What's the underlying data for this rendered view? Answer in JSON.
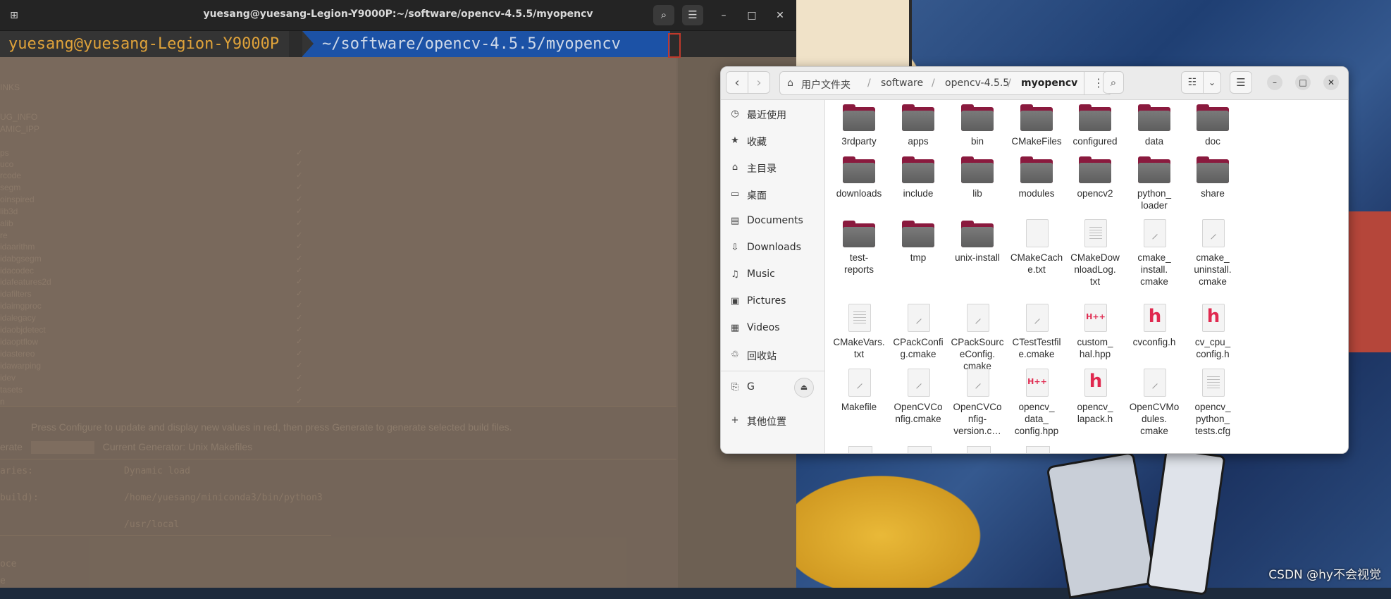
{
  "terminal": {
    "title": "yuesang@yuesang-Legion-Y9000P:~/software/opencv-4.5.5/myopencv",
    "prompt_user": "yuesang@yuesang-Legion-Y9000P",
    "prompt_path": "~/software/opencv-4.5.5/myopencv",
    "buttons": {
      "new_tab": "⊞",
      "search": "⌕",
      "menu": "☰",
      "minimize": "–",
      "maximize": "□",
      "close": "✕"
    }
  },
  "background_app": {
    "rows": [
      "INKS",
      "UG_INFO",
      "AMIC_IPP",
      "ps",
      "uco",
      "rcode",
      "segm",
      "oinspired",
      "lib3d",
      "alib",
      "re",
      "idaarithm",
      "idabgsegm",
      "idacodec",
      "idafeatures2d",
      "idafilters",
      "idaimgproc",
      "idalegacy",
      "idaobjdetect",
      "idaoptflow",
      "idastereo",
      "idawarping",
      "idev",
      "tasets",
      "n"
    ],
    "message": "Press Configure to update and display new values in red, then press Generate to generate selected build files.",
    "generate_label": "erate",
    "generator_label": "Current Generator: Unix Makefiles",
    "code_lines": [
      {
        "left": "aries:",
        "right": "Dynamic load"
      },
      {
        "left": " build):",
        "right": "/home/yuesang/miniconda3/bin/python3"
      },
      {
        "left": "",
        "right": "/usr/local"
      },
      {
        "left": "oce",
        "right": ""
      },
      {
        "left": "e",
        "right": ""
      }
    ]
  },
  "files": {
    "path": [
      "用户文件夹",
      "software",
      "opencv-4.5.5",
      "myopencv"
    ],
    "toolbar": {
      "back": "‹",
      "forward": "›",
      "path_menu": "⋮",
      "search": "⌕",
      "view": "☷",
      "view_dropdown": "⌄",
      "menu": "☰",
      "minimize": "–",
      "maximize": "□",
      "close": "✕"
    },
    "sidebar": [
      {
        "label": "最近使用",
        "icon": "clock-icon",
        "glyph": "◷"
      },
      {
        "label": "收藏",
        "icon": "star-icon",
        "glyph": "★"
      },
      {
        "label": "主目录",
        "icon": "home-icon",
        "glyph": "⌂"
      },
      {
        "label": "桌面",
        "icon": "desktop-icon",
        "glyph": "▭"
      },
      {
        "label": "Documents",
        "icon": "document-icon",
        "glyph": "▤"
      },
      {
        "label": "Downloads",
        "icon": "download-icon",
        "glyph": "⇩"
      },
      {
        "label": "Music",
        "icon": "music-icon",
        "glyph": "♫"
      },
      {
        "label": "Pictures",
        "icon": "picture-icon",
        "glyph": "▣"
      },
      {
        "label": "Videos",
        "icon": "video-icon",
        "glyph": "▦"
      },
      {
        "label": "回收站",
        "icon": "trash-icon",
        "glyph": "♲"
      },
      {
        "label": "G",
        "icon": "usb-drive-icon",
        "glyph": "⎘"
      },
      {
        "label": "其他位置",
        "icon": "plus-icon",
        "glyph": "+"
      }
    ],
    "eject": "⏏",
    "items": [
      {
        "name": "3rdparty",
        "type": "folder"
      },
      {
        "name": "apps",
        "type": "folder"
      },
      {
        "name": "bin",
        "type": "folder"
      },
      {
        "name": "CMakeFiles",
        "type": "folder"
      },
      {
        "name": "configured",
        "type": "folder"
      },
      {
        "name": "data",
        "type": "folder"
      },
      {
        "name": "doc",
        "type": "folder"
      },
      {
        "name": "downloads",
        "type": "folder"
      },
      {
        "name": "include",
        "type": "folder"
      },
      {
        "name": "lib",
        "type": "folder"
      },
      {
        "name": "modules",
        "type": "folder"
      },
      {
        "name": "opencv2",
        "type": "folder"
      },
      {
        "name": "python_\nloader",
        "type": "folder"
      },
      {
        "name": "share",
        "type": "folder"
      },
      {
        "name": "test-\nreports",
        "type": "folder"
      },
      {
        "name": "tmp",
        "type": "folder"
      },
      {
        "name": "unix-install",
        "type": "folder"
      },
      {
        "name": "CMakeCach\ne.txt",
        "type": "blank"
      },
      {
        "name": "CMakeDow\nnloadLog.\ntxt",
        "type": "text"
      },
      {
        "name": "cmake_\ninstall.\ncmake",
        "type": "script"
      },
      {
        "name": "cmake_\nuninstall.\ncmake",
        "type": "script"
      },
      {
        "name": "CMakeVars.\ntxt",
        "type": "text"
      },
      {
        "name": "CPackConfi\ng.cmake",
        "type": "script"
      },
      {
        "name": "CPackSourc\neConfig.\ncmake",
        "type": "script"
      },
      {
        "name": "CTestTestfil\ne.cmake",
        "type": "script"
      },
      {
        "name": "custom_\nhal.hpp",
        "type": "hpp"
      },
      {
        "name": "cvconfig.h",
        "type": "header"
      },
      {
        "name": "cv_cpu_\nconfig.h",
        "type": "header"
      },
      {
        "name": "Makefile",
        "type": "script"
      },
      {
        "name": "OpenCVCo\nnfig.cmake",
        "type": "script"
      },
      {
        "name": "OpenCVCo\nnfig-\nversion.c…",
        "type": "script"
      },
      {
        "name": "opencv_\ndata_\nconfig.hpp",
        "type": "hpp"
      },
      {
        "name": "opencv_\nlapack.h",
        "type": "header"
      },
      {
        "name": "OpenCVMo\ndules.\ncmake",
        "type": "script"
      },
      {
        "name": "opencv_\npython_\ntests.cfg",
        "type": "text"
      }
    ]
  },
  "watermark": "CSDN @hy不会视觉",
  "colors": {
    "folder_accent": "#8a1a3e",
    "prompt_path_bg": "#1c52a6",
    "prompt_user_fg": "#e0a33a"
  }
}
